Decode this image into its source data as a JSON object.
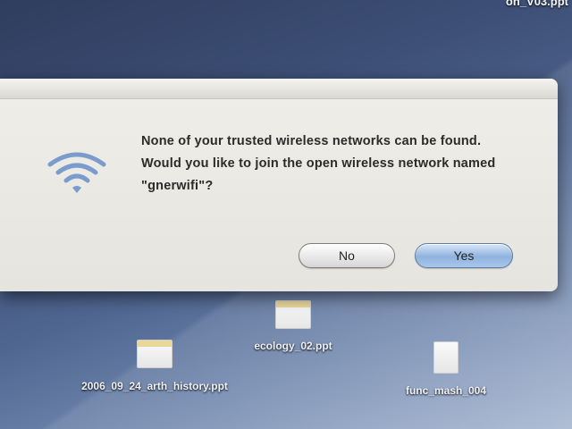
{
  "desktop": {
    "top_file_label": "on_V03.ppt",
    "icons": [
      {
        "label": "ecology_02.ppt"
      },
      {
        "label": "2006_09_24_arth_history.ppt"
      },
      {
        "label": "func_mash_004"
      }
    ]
  },
  "dialog": {
    "icon": "wifi-icon",
    "message": "None of your trusted wireless networks can be found. Would you like to join the open wireless network named \"gnerwifi\"?",
    "buttons": {
      "no_label": "No",
      "yes_label": "Yes"
    }
  },
  "colors": {
    "dialog_bg": "#ebe9e4",
    "default_button": "#8fb3df",
    "wifi_icon": "#6b8fc4"
  }
}
